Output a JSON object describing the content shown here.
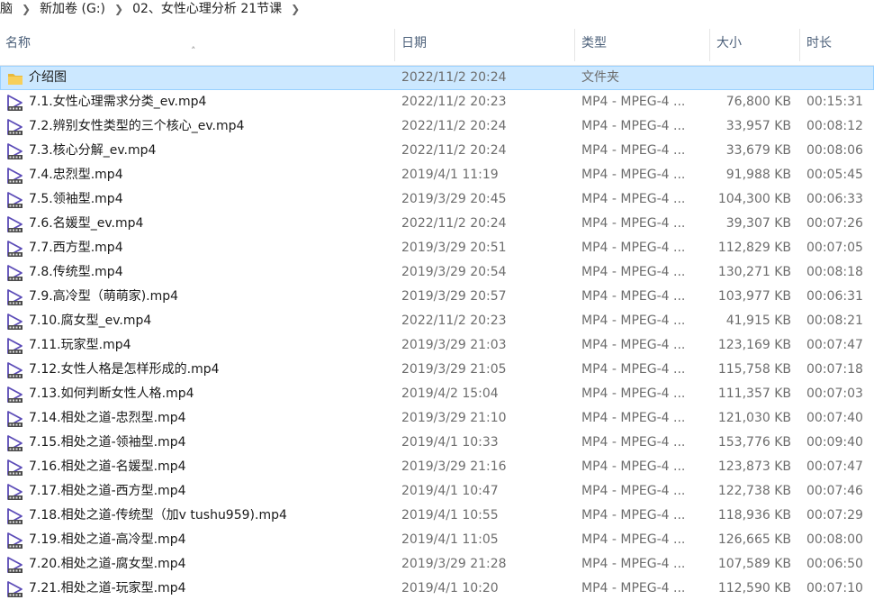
{
  "breadcrumb": [
    "脑",
    "新加卷 (G:)",
    "02、女性心理分析 21节课"
  ],
  "columns": {
    "name": "名称",
    "date": "日期",
    "type": "类型",
    "size": "大小",
    "duration": "时长"
  },
  "colors": {
    "selected_bg": "#cce8ff",
    "header_text": "#4c607a",
    "video_icon": "#5b4bb7",
    "folder": "#f5c44e"
  },
  "files": [
    {
      "name": "介绍图",
      "date": "2022/11/2 20:24",
      "type": "文件夹",
      "size": "",
      "duration": "",
      "icon": "folder-icon",
      "selected": true
    },
    {
      "name": "7.1.女性心理需求分类_ev.mp4",
      "date": "2022/11/2 20:23",
      "type": "MP4 - MPEG-4 ...",
      "size": "76,800 KB",
      "duration": "00:15:31",
      "icon": "video-file-icon"
    },
    {
      "name": "7.2.辨别女性类型的三个核心_ev.mp4",
      "date": "2022/11/2 20:24",
      "type": "MP4 - MPEG-4 ...",
      "size": "33,957 KB",
      "duration": "00:08:12",
      "icon": "video-file-icon"
    },
    {
      "name": "7.3.核心分解_ev.mp4",
      "date": "2022/11/2 20:24",
      "type": "MP4 - MPEG-4 ...",
      "size": "33,679 KB",
      "duration": "00:08:06",
      "icon": "video-file-icon"
    },
    {
      "name": "7.4.忠烈型.mp4",
      "date": "2019/4/1 11:19",
      "type": "MP4 - MPEG-4 ...",
      "size": "91,988 KB",
      "duration": "00:05:45",
      "icon": "video-file-icon"
    },
    {
      "name": "7.5.领袖型.mp4",
      "date": "2019/3/29 20:45",
      "type": "MP4 - MPEG-4 ...",
      "size": "104,300 KB",
      "duration": "00:06:33",
      "icon": "video-file-icon"
    },
    {
      "name": "7.6.名媛型_ev.mp4",
      "date": "2022/11/2 20:24",
      "type": "MP4 - MPEG-4 ...",
      "size": "39,307 KB",
      "duration": "00:07:26",
      "icon": "video-file-icon"
    },
    {
      "name": "7.7.西方型.mp4",
      "date": "2019/3/29 20:51",
      "type": "MP4 - MPEG-4 ...",
      "size": "112,829 KB",
      "duration": "00:07:05",
      "icon": "video-file-icon"
    },
    {
      "name": "7.8.传统型.mp4",
      "date": "2019/3/29 20:54",
      "type": "MP4 - MPEG-4 ...",
      "size": "130,271 KB",
      "duration": "00:08:18",
      "icon": "video-file-icon"
    },
    {
      "name": "7.9.高冷型（萌萌家).mp4",
      "date": "2019/3/29 20:57",
      "type": "MP4 - MPEG-4 ...",
      "size": "103,977 KB",
      "duration": "00:06:31",
      "icon": "video-file-icon"
    },
    {
      "name": "7.10.腐女型_ev.mp4",
      "date": "2022/11/2 20:23",
      "type": "MP4 - MPEG-4 ...",
      "size": "41,915 KB",
      "duration": "00:08:21",
      "icon": "video-file-icon"
    },
    {
      "name": "7.11.玩家型.mp4",
      "date": "2019/3/29 21:03",
      "type": "MP4 - MPEG-4 ...",
      "size": "123,169 KB",
      "duration": "00:07:47",
      "icon": "video-file-icon"
    },
    {
      "name": "7.12.女性人格是怎样形成的.mp4",
      "date": "2019/3/29 21:05",
      "type": "MP4 - MPEG-4 ...",
      "size": "115,758 KB",
      "duration": "00:07:18",
      "icon": "video-file-icon"
    },
    {
      "name": "7.13.如何判断女性人格.mp4",
      "date": "2019/4/2 15:04",
      "type": "MP4 - MPEG-4 ...",
      "size": "111,357 KB",
      "duration": "00:07:03",
      "icon": "video-file-icon"
    },
    {
      "name": "7.14.相处之道-忠烈型.mp4",
      "date": "2019/3/29 21:10",
      "type": "MP4 - MPEG-4 ...",
      "size": "121,030 KB",
      "duration": "00:07:40",
      "icon": "video-file-icon"
    },
    {
      "name": "7.15.相处之道-领袖型.mp4",
      "date": "2019/4/1 10:33",
      "type": "MP4 - MPEG-4 ...",
      "size": "153,776 KB",
      "duration": "00:09:40",
      "icon": "video-file-icon"
    },
    {
      "name": "7.16.相处之道-名媛型.mp4",
      "date": "2019/3/29 21:16",
      "type": "MP4 - MPEG-4 ...",
      "size": "123,873 KB",
      "duration": "00:07:47",
      "icon": "video-file-icon"
    },
    {
      "name": "7.17.相处之道-西方型.mp4",
      "date": "2019/4/1 10:47",
      "type": "MP4 - MPEG-4 ...",
      "size": "122,738 KB",
      "duration": "00:07:46",
      "icon": "video-file-icon"
    },
    {
      "name": "7.18.相处之道-传统型（加v tushu959).mp4",
      "date": "2019/4/1 10:55",
      "type": "MP4 - MPEG-4 ...",
      "size": "118,936 KB",
      "duration": "00:07:29",
      "icon": "video-file-icon"
    },
    {
      "name": "7.19.相处之道-高冷型.mp4",
      "date": "2019/4/1 11:05",
      "type": "MP4 - MPEG-4 ...",
      "size": "126,665 KB",
      "duration": "00:08:00",
      "icon": "video-file-icon"
    },
    {
      "name": "7.20.相处之道-腐女型.mp4",
      "date": "2019/3/29 21:28",
      "type": "MP4 - MPEG-4 ...",
      "size": "107,589 KB",
      "duration": "00:06:50",
      "icon": "video-file-icon"
    },
    {
      "name": "7.21.相处之道-玩家型.mp4",
      "date": "2019/4/1 10:20",
      "type": "MP4 - MPEG-4 ...",
      "size": "112,590 KB",
      "duration": "00:07:10",
      "icon": "video-file-icon"
    }
  ]
}
